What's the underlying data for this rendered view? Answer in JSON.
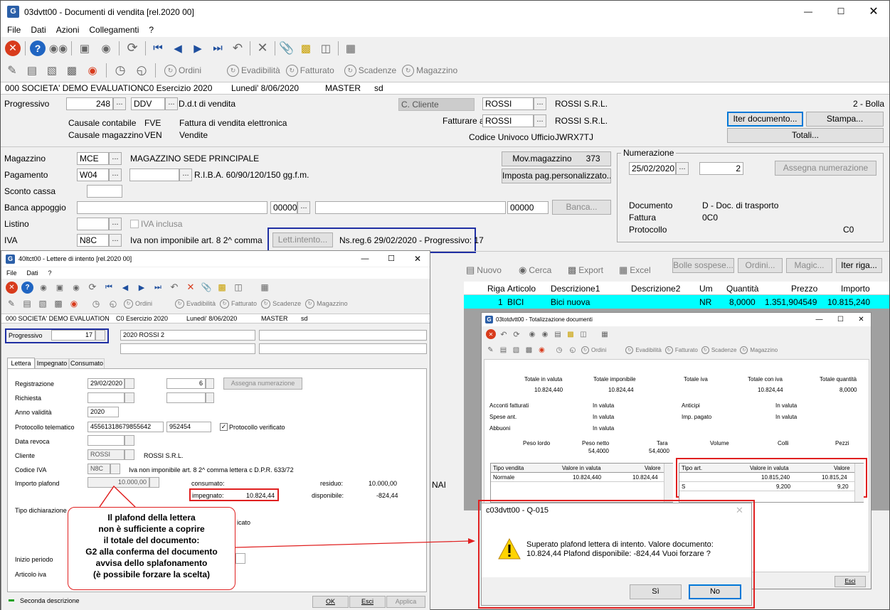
{
  "main": {
    "title": "03dvtt00 - Documenti di vendita  [rel.2020 00]",
    "menu": [
      "File",
      "Dati",
      "Azioni",
      "Collegamenti",
      "?"
    ],
    "nav_links": [
      "Ordini",
      "Evadibilità",
      "Fatturato",
      "Scadenze",
      "Magazzino"
    ],
    "status": {
      "company": "000 SOCIETA' DEMO EVALUATION",
      "exercise": "C0 Esercizio 2020",
      "date": "Lunedi' 8/06/2020",
      "user": "MASTER",
      "extra": "sd"
    },
    "progressivo_label": "Progressivo",
    "progressivo": "248",
    "doc_code": "DDV",
    "doc_desc": "D.d.t di vendita",
    "causale_contabile_label": "Causale contabile",
    "causale_contabile": "FVE",
    "causale_contabile_desc": "Fattura di vendita elettronica",
    "causale_magazzino_label": "Causale magazzino",
    "causale_magazzino": "VEN",
    "causale_magazzino_desc": "Vendite",
    "cliente_type": "C. Cliente",
    "cliente_code": "ROSSI",
    "cliente_name": "ROSSI S.R.L.",
    "fatturare_label": "Fatturare a",
    "fatturare_code": "ROSSI",
    "fatturare_name": "ROSSI S.R.L.",
    "codice_univoco_label": "Codice Univoco Ufficio",
    "codice_univoco": "JWRX7TJ",
    "doc_type": "2 - Bolla",
    "btn_iter": "Iter documento...",
    "btn_stampa": "Stampa...",
    "btn_totali": "Totali...",
    "magazzino_label": "Magazzino",
    "magazzino": "MCE",
    "magazzino_desc": "MAGAZZINO SEDE PRINCIPALE",
    "pagamento_label": "Pagamento",
    "pagamento": "W04",
    "pagamento_desc": "R.I.B.A. 60/90/120/150 gg.f.m.",
    "sconto_label": "Sconto cassa",
    "banca_label": "Banca appoggio",
    "abi": "00000",
    "cab": "00000",
    "btn_banca": "Banca...",
    "listino_label": "Listino",
    "iva_inclusa": "IVA inclusa",
    "iva_label": "IVA",
    "iva": "N8C",
    "iva_desc": "Iva non imponibile art. 8 2^ comma",
    "btn_mov": "Mov.magazzino",
    "mov_count": "373",
    "btn_imposta": "Imposta pag.personalizzato...",
    "btn_lett": "Lett.intento...",
    "lett_info": "Ns.reg.6 29/02/2020  - Progressivo: 17",
    "numerazione_title": "Numerazione",
    "num_date": "25/02/2020",
    "num_value": "2",
    "btn_assegna": "Assegna numerazione",
    "documento_label": "Documento",
    "documento": "D - Doc. di trasporto",
    "fattura_label": "Fattura",
    "fattura": "0C0",
    "protocollo_label": "Protocollo",
    "protocollo": "C0",
    "grid_tools": [
      "Nuovo",
      "Cerca",
      "Export",
      "Excel"
    ],
    "grid_buttons": [
      "Bolle sospese...",
      "Ordini...",
      "Magic...",
      "Iter riga..."
    ],
    "grid_headers": [
      "Riga",
      "Articolo",
      "Descrizione1",
      "Descrizione2",
      "Um",
      "Quantità",
      "Prezzo",
      "Importo"
    ],
    "grid_row": [
      "1",
      "BICI",
      "Bici nuova",
      "",
      "NR",
      "8,0000",
      "1.351,904549",
      "10.815,240"
    ],
    "left_partial": "NAI"
  },
  "lettere": {
    "title": "40ltct00 - Lettere di intento  [rel.2020 00]",
    "menu": [
      "File",
      "Dati",
      "?"
    ],
    "nav_links": [
      "Ordini",
      "Evadibilità",
      "Fatturato",
      "Scadenze",
      "Magazzino"
    ],
    "status": {
      "company": "000 SOCIETA' DEMO EVALUATION",
      "exercise": "C0 Esercizio 2020",
      "date": "Lunedi' 8/06/2020",
      "user": "MASTER",
      "extra": "sd"
    },
    "progressivo_label": "Progressivo",
    "progressivo": "17",
    "desc1": "2020 ROSSI 2",
    "tabs": [
      "Lettera",
      "Impegnato",
      "Consumato"
    ],
    "registrazione_label": "Registrazione",
    "registrazione": "29/02/2020",
    "reg_num": "6",
    "btn_assegna": "Assegna numerazione",
    "richiesta_label": "Richiesta",
    "anno_label": "Anno validità",
    "anno": "2020",
    "protocollo_label": "Protocollo telematico",
    "protocollo": "45561318679855642",
    "protocollo2": "952454",
    "protocollo_verificato": "Protocollo verificato",
    "revoca_label": "Data revoca",
    "cliente_label": "Cliente",
    "cliente": "ROSSI",
    "cliente_name": "ROSSI S.R.L.",
    "codice_iva_label": "Codice IVA",
    "codice_iva": "N8C",
    "codice_iva_desc": "Iva non imponibile art. 8 2^ comma lettera c D.P.R. 633/72",
    "plafond_label": "Importo plafond",
    "plafond": "10.000,00",
    "consumato_label": "consumato:",
    "residuo_label": "residuo:",
    "residuo": "10.000,00",
    "impegnato_label": "impegnato:",
    "impegnato": "10.824,44",
    "disponibile_label": "disponibile:",
    "disponibile": "-824,44",
    "tipo_dich_label": "Tipo dichiarazione",
    "tipo_dich_partial": "icato",
    "inizio_label": "Inizio periodo",
    "articolo_label": "Articolo iva",
    "seconda": "Seconda descrizione",
    "btn_ok": "OK",
    "btn_esci": "Esci",
    "btn_applica": "Applica"
  },
  "callout": {
    "lines": [
      "Il plafond della lettera",
      "non è sufficiente a coprire",
      "il totale del documento:",
      "G2 alla conferma del documento",
      "avvisa dello splafonamento",
      "(è possibile forzare la scelta)"
    ]
  },
  "totali": {
    "title": "03totdvtt00 - Totalizzazione documenti",
    "nav_links": [
      "Ordini",
      "Evadibilità",
      "Fatturato",
      "Scadenze",
      "Magazzino"
    ],
    "headers": [
      "Totale in valuta",
      "Totale imponibile",
      "Totale iva",
      "Totale con iva",
      "Totale quantità"
    ],
    "values": [
      "10.824,440",
      "10.824,44",
      "",
      "10.824,44",
      "8,0000"
    ],
    "acconti_label": "Acconti fatturati",
    "acconti": "In valuta",
    "anticipi_label": "Anticipi",
    "anticipi": "In valuta",
    "spese_label": "Spese ant.",
    "spese": "In valuta",
    "imp_pagato_label": "Imp. pagato",
    "imp_pagato": "In valuta",
    "abbuoni_label": "Abbuoni",
    "abbuoni": "In valuta",
    "peso_headers": [
      "Peso lordo",
      "Peso netto",
      "Tara",
      "Volume",
      "Colli",
      "Pezzi"
    ],
    "peso_values": [
      "",
      "54,4000",
      "54,4000",
      "",
      "",
      ""
    ],
    "t1_headers": [
      "Tipo vendita",
      "Valore in valuta",
      "Valore"
    ],
    "t1_row": [
      "Normale",
      "10.824,440",
      "10.824,44"
    ],
    "t2_headers": [
      "Tipo art.",
      "Valore in valuta",
      "Valore"
    ],
    "t2_rows": [
      [
        "",
        "10.815,240",
        "10.815,24"
      ],
      [
        "S",
        "9,200",
        "9,20"
      ]
    ],
    "btn_esci": "Esci"
  },
  "dialog": {
    "title": "c03dvtt00 - Q-015",
    "message1": "Superato plafond lettera di intento. Valore documento:",
    "message2": "10.824,44 Plafond disponibile: -824,44 Vuoi forzare ?",
    "btn_si": "Sì",
    "btn_no": "No"
  }
}
